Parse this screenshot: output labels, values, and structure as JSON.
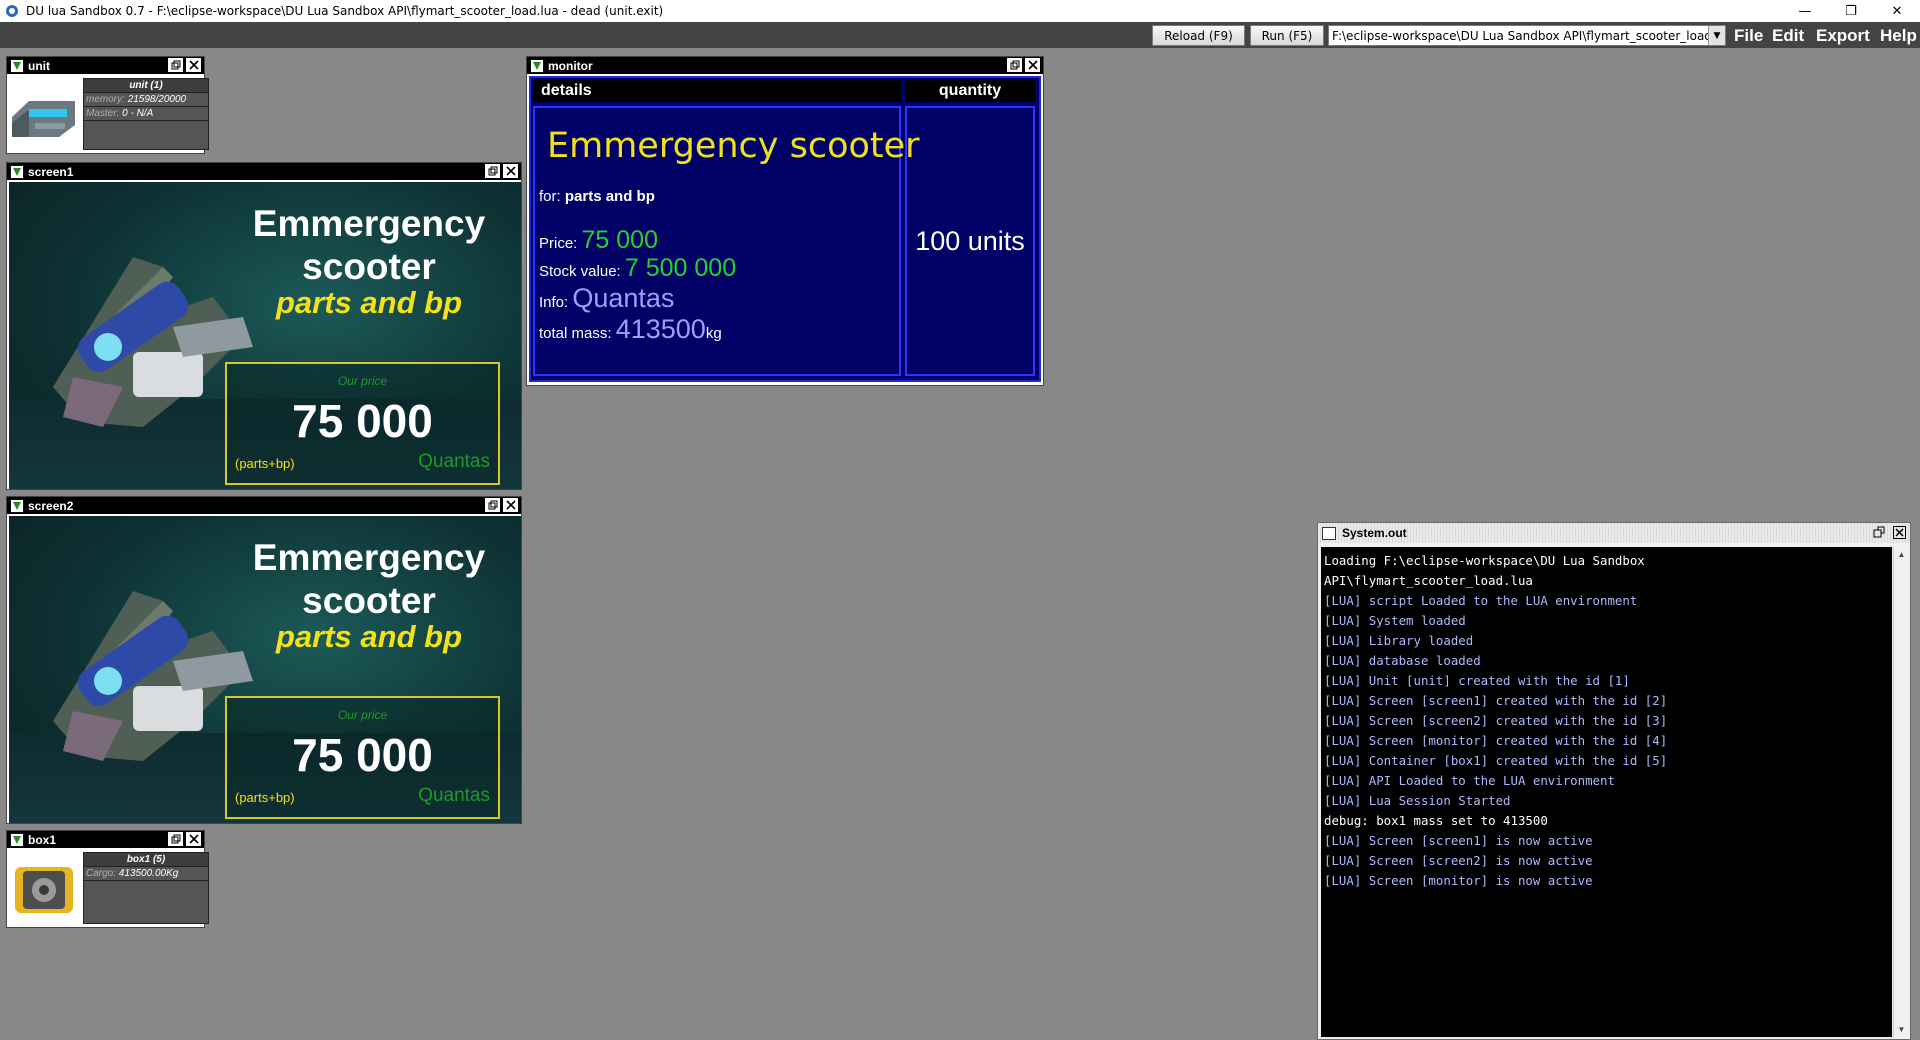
{
  "window": {
    "title": "DU lua Sandbox 0.7 - F:\\eclipse-workspace\\DU Lua Sandbox API\\flymart_scooter_load.lua - dead (unit.exit)",
    "minimize": "—",
    "maximize": "❐",
    "close": "✕"
  },
  "toolbar": {
    "reload": "Reload (F9)",
    "run": "Run (F5)",
    "path": "F:\\eclipse-workspace\\DU Lua Sandbox API\\flymart_scooter_load...",
    "menus": [
      "File",
      "Edit",
      "Export",
      "Help"
    ]
  },
  "unit": {
    "title": "unit",
    "header": "unit (1)",
    "rows": [
      {
        "key": "memory:",
        "value": "21598/20000"
      },
      {
        "key": "Master:",
        "value": "0 - N/A"
      }
    ]
  },
  "box1": {
    "title": "box1",
    "header": "box1 (5)",
    "rows": [
      {
        "key": "Cargo:",
        "value": "413500.00Kg"
      }
    ]
  },
  "screen1": {
    "title": "screen1",
    "name_line1": "Emmergency",
    "name_line2": "scooter",
    "subtitle": "parts and bp",
    "our_price": "Our price",
    "price": "75 000",
    "price_note": "(parts+bp)",
    "currency": "Quantas"
  },
  "screen2": {
    "title": "screen2",
    "name_line1": "Emmergency",
    "name_line2": "scooter",
    "subtitle": "parts and bp",
    "our_price": "Our price",
    "price": "75 000",
    "price_note": "(parts+bp)",
    "currency": "Quantas"
  },
  "monitor": {
    "title": "monitor",
    "col_details": "details",
    "col_quantity": "quantity",
    "product": "Emmergency scooter",
    "for_label": "for:",
    "for_value": "parts and bp",
    "price_label": "Price:",
    "price_value": "75 000",
    "stock_label": "Stock value:",
    "stock_value": "7 500 000",
    "info_label": "Info:",
    "info_value": "Quantas",
    "mass_label": "total mass:",
    "mass_value": "413500",
    "mass_unit": "kg",
    "quantity": "100 units"
  },
  "sysout": {
    "title": "System.out",
    "lines": [
      {
        "text": "Loading F:\\eclipse-workspace\\DU Lua Sandbox",
        "kind": "plain"
      },
      {
        "text": "API\\flymart_scooter_load.lua",
        "kind": "plain"
      },
      {
        "text": "[LUA] script Loaded to the LUA environment",
        "kind": "lua"
      },
      {
        "text": "[LUA] System loaded",
        "kind": "lua"
      },
      {
        "text": "[LUA] Library loaded",
        "kind": "lua"
      },
      {
        "text": "[LUA] database loaded",
        "kind": "lua"
      },
      {
        "text": "[LUA] Unit [unit] created with the id [1]",
        "kind": "lua"
      },
      {
        "text": "[LUA] Screen [screen1] created with the id [2]",
        "kind": "lua"
      },
      {
        "text": "[LUA] Screen [screen2] created with the id [3]",
        "kind": "lua"
      },
      {
        "text": "[LUA] Screen [monitor] created with the id [4]",
        "kind": "lua"
      },
      {
        "text": "[LUA] Container [box1] created with the id [5]",
        "kind": "lua"
      },
      {
        "text": "[LUA] API Loaded to the LUA environment",
        "kind": "lua"
      },
      {
        "text": "[LUA] Lua Session Started",
        "kind": "lua"
      },
      {
        "text": "debug: box1 mass set to 413500",
        "kind": "plain"
      },
      {
        "text": "[LUA] Screen [screen1] is now active",
        "kind": "lua"
      },
      {
        "text": "[LUA] Screen [screen2] is now active",
        "kind": "lua"
      },
      {
        "text": "[LUA] Screen [monitor] is now active",
        "kind": "lua"
      }
    ]
  }
}
